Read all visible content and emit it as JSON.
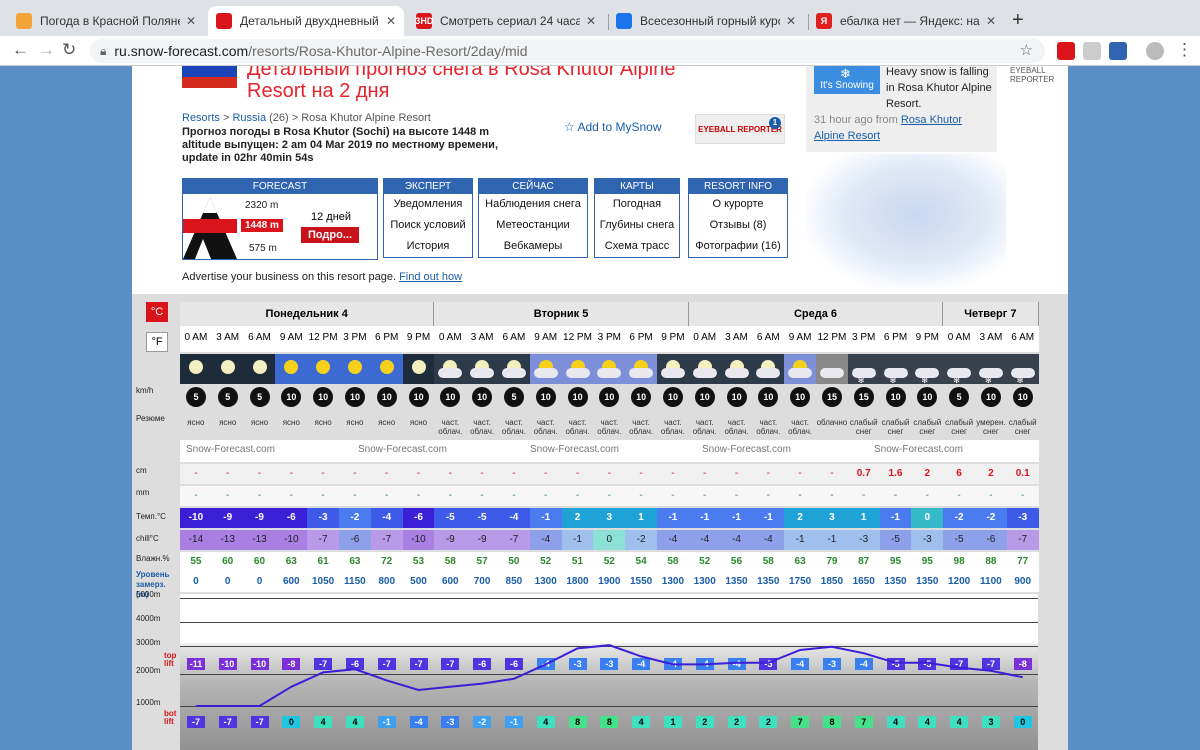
{
  "browser": {
    "tabs": [
      {
        "label": "Погода в Красной Поляне - С",
        "color": "#f2a43a",
        "icon": "cloud-icon"
      },
      {
        "label": "Детальный двухдневный прог",
        "color": "#d9151b",
        "icon": "snowflake-icon",
        "active": true
      },
      {
        "label": "Смотреть сериал 24 часа (20",
        "color": "#d9151b",
        "icon": "hd-icon",
        "favtext": "ЗНD"
      },
      {
        "label": "Всесезонный горный курорт",
        "color": "#1a73e8",
        "icon": "mountain-icon"
      },
      {
        "label": "ебалка нет — Яндекс: нашло",
        "color": "#e02020",
        "icon": "yandex-icon",
        "favtext": "Я"
      }
    ],
    "url_host": "ru.snow-forecast.com",
    "url_path": "/resorts/Rosa-Khutor-Alpine-Resort/2day/mid"
  },
  "header": {
    "title": "Детальный прогноз снега в Rosa Khutor Alpine Resort на 2 дня",
    "crumb_resorts": "Resorts",
    "crumb_sep1": " > ",
    "crumb_country": "Russia",
    "crumb_count": " (26) > ",
    "crumb_resort": "Rosa Khutor Alpine Resort",
    "issued": "Прогноз погоды в Rosa Khutor (Sochi) на высоте 1448 m altitude выпущен: 2 am  04 Mar 2019 по местному времени, update in 02hr 40min 54s",
    "add_mysnow": "Add to MySnow",
    "eyeball_label": "EYEBALL REPORTER",
    "eyeball_count": "1"
  },
  "snowcard": {
    "badge": "It's Snowing",
    "headline": "Heavy snow is falling in Rosa Khutor Alpine Resort.",
    "ago": "31 hour ago from",
    "link": "Rosa Khutor Alpine Resort",
    "eyeball_top": "EYEBALL REPORTER"
  },
  "forecast_box": {
    "header": "FORECAST",
    "alt_top": "2320 m",
    "alt_mid": "1448 m",
    "alt_bot": "575 m",
    "days": "12 дней",
    "button": "Подро..."
  },
  "menus": [
    {
      "header": "ЭКСПЕРТ",
      "items": [
        "Уведомления",
        "Поиск условий",
        "История"
      ]
    },
    {
      "header": "СЕЙЧАС",
      "items": [
        "Наблюдения снега",
        "Метеостанции",
        "Вебкамеры"
      ]
    },
    {
      "header": "КАРТЫ",
      "items": [
        "Погодная",
        "Глубины снега",
        "Схема трасс"
      ]
    },
    {
      "header": "RESORT INFO",
      "items": [
        "О курорте",
        "Отзывы (8)",
        "Фотографии (16)"
      ]
    }
  ],
  "advertise": "Advertise your business on this resort page.",
  "advertise_link": "Find out how",
  "units": {
    "c": "°C",
    "f": "°F"
  },
  "days": [
    {
      "name": "Понедельник 4",
      "cols": 8
    },
    {
      "name": "Вторник 5",
      "cols": 8
    },
    {
      "name": "Среда 6",
      "cols": 8
    },
    {
      "name": "Четверг 7",
      "cols": 3
    }
  ],
  "times": [
    "0 AM",
    "3 AM",
    "6 AM",
    "9 AM",
    "12 PM",
    "3 PM",
    "6 PM",
    "9 PM",
    "0 AM",
    "3 AM",
    "6 AM",
    "9 AM",
    "12 PM",
    "3 PM",
    "6 PM",
    "9 PM",
    "0 AM",
    "3 AM",
    "6 AM",
    "9 AM",
    "12 PM",
    "3 PM",
    "6 PM",
    "9 PM",
    "0 AM",
    "3 AM",
    "6 AM"
  ],
  "wx_icons": [
    "moon",
    "moon",
    "moon",
    "sun",
    "sun",
    "sun",
    "sun",
    "moon",
    "moon-cloud",
    "moon-cloud",
    "moon-cloud",
    "sun-cloud",
    "sun-cloud",
    "sun-cloud",
    "sun-cloud",
    "moon-cloud",
    "moon-cloud",
    "moon-cloud",
    "moon-cloud",
    "sun-cloud",
    "cloud",
    "snow",
    "snow",
    "snow",
    "snow",
    "snow",
    "snow"
  ],
  "wind": [
    5,
    5,
    5,
    10,
    10,
    10,
    10,
    10,
    10,
    10,
    5,
    10,
    10,
    10,
    10,
    10,
    10,
    10,
    10,
    10,
    15,
    15,
    10,
    10,
    5,
    10,
    10
  ],
  "summary": [
    "ясно",
    "ясно",
    "ясно",
    "ясно",
    "ясно",
    "ясно",
    "ясно",
    "ясно",
    "част. облач.",
    "част. облач.",
    "част. облач.",
    "част. облач.",
    "част. облач.",
    "част. облач.",
    "част. облач.",
    "част. облач.",
    "част. облач.",
    "част. облач.",
    "част. облач.",
    "част. облач.",
    "облачно",
    "слабый снег",
    "слабый снег",
    "слабый снег",
    "слабый снег",
    "умерен. снег",
    "слабый снег"
  ],
  "watermark": "Snow-Forecast.com",
  "snow_cm": [
    "-",
    "-",
    "-",
    "-",
    "-",
    "-",
    "-",
    "-",
    "-",
    "-",
    "-",
    "-",
    "-",
    "-",
    "-",
    "-",
    "-",
    "-",
    "-",
    "-",
    "-",
    "0.7",
    "1.6",
    "2",
    "6",
    "2",
    "0.1"
  ],
  "rain_mm": [
    "-",
    "-",
    "-",
    "-",
    "-",
    "-",
    "-",
    "-",
    "-",
    "-",
    "-",
    "-",
    "-",
    "-",
    "-",
    "-",
    "-",
    "-",
    "-",
    "-",
    "-",
    "-",
    "-",
    "-",
    "-",
    "-",
    "-"
  ],
  "temp": [
    -10,
    -9,
    -9,
    -6,
    -3,
    -2,
    -4,
    -6,
    -5,
    -5,
    -4,
    -1,
    2,
    3,
    1,
    -1,
    -1,
    -1,
    -1,
    2,
    3,
    1,
    -1,
    0,
    -2,
    -2,
    -3
  ],
  "chill": [
    -14,
    -13,
    -13,
    -10,
    -7,
    -6,
    -7,
    -10,
    -9,
    -9,
    -7,
    -4,
    -1,
    0,
    -2,
    -4,
    -4,
    -4,
    -4,
    -1,
    -1,
    -3,
    -5,
    -3,
    -5,
    -6,
    -7
  ],
  "humidity": [
    55,
    60,
    60,
    63,
    61,
    63,
    72,
    53,
    58,
    57,
    50,
    52,
    51,
    52,
    54,
    58,
    52,
    56,
    58,
    63,
    79,
    87,
    95,
    95,
    98,
    88,
    77
  ],
  "freeze": [
    0,
    0,
    0,
    600,
    1050,
    1150,
    800,
    500,
    600,
    700,
    850,
    1300,
    1800,
    1900,
    1550,
    1300,
    1300,
    1350,
    1350,
    1750,
    1850,
    1650,
    1350,
    1350,
    1200,
    1100,
    900
  ],
  "row_labels": {
    "wind": "km/h",
    "summary": "Резюме",
    "snow": "cm",
    "rain": "mm",
    "temp": "Темп.°C",
    "chill": "chill°C",
    "humidity": "Влажн.%",
    "freeze": "Уровень замерз. (m)"
  },
  "alt_levels": [
    "5000m",
    "4000m",
    "3000m",
    "2000m",
    "1000m"
  ],
  "lift_labels": {
    "top": "top lift",
    "bot": "bot lift"
  },
  "top_lift_temps": [
    -11,
    -10,
    -10,
    -8,
    -7,
    -6,
    -7,
    -7,
    -7,
    -6,
    -6,
    -4,
    -3,
    -3,
    -4,
    -4,
    -4,
    -4,
    -5,
    -4,
    -3,
    -4,
    -5,
    -5,
    -7,
    -7,
    -8
  ],
  "bot_lift_temps": [
    -7,
    -7,
    -7,
    0,
    4,
    4,
    -1,
    -4,
    -3,
    -2,
    -1,
    4,
    8,
    8,
    4,
    1,
    2,
    2,
    2,
    7,
    8,
    7,
    4,
    4,
    4,
    3,
    0
  ],
  "colors": {
    "red": "#d9151b",
    "blue": "#2f64b0",
    "link": "#1a5ea8",
    "green": "#2a8a2a"
  }
}
